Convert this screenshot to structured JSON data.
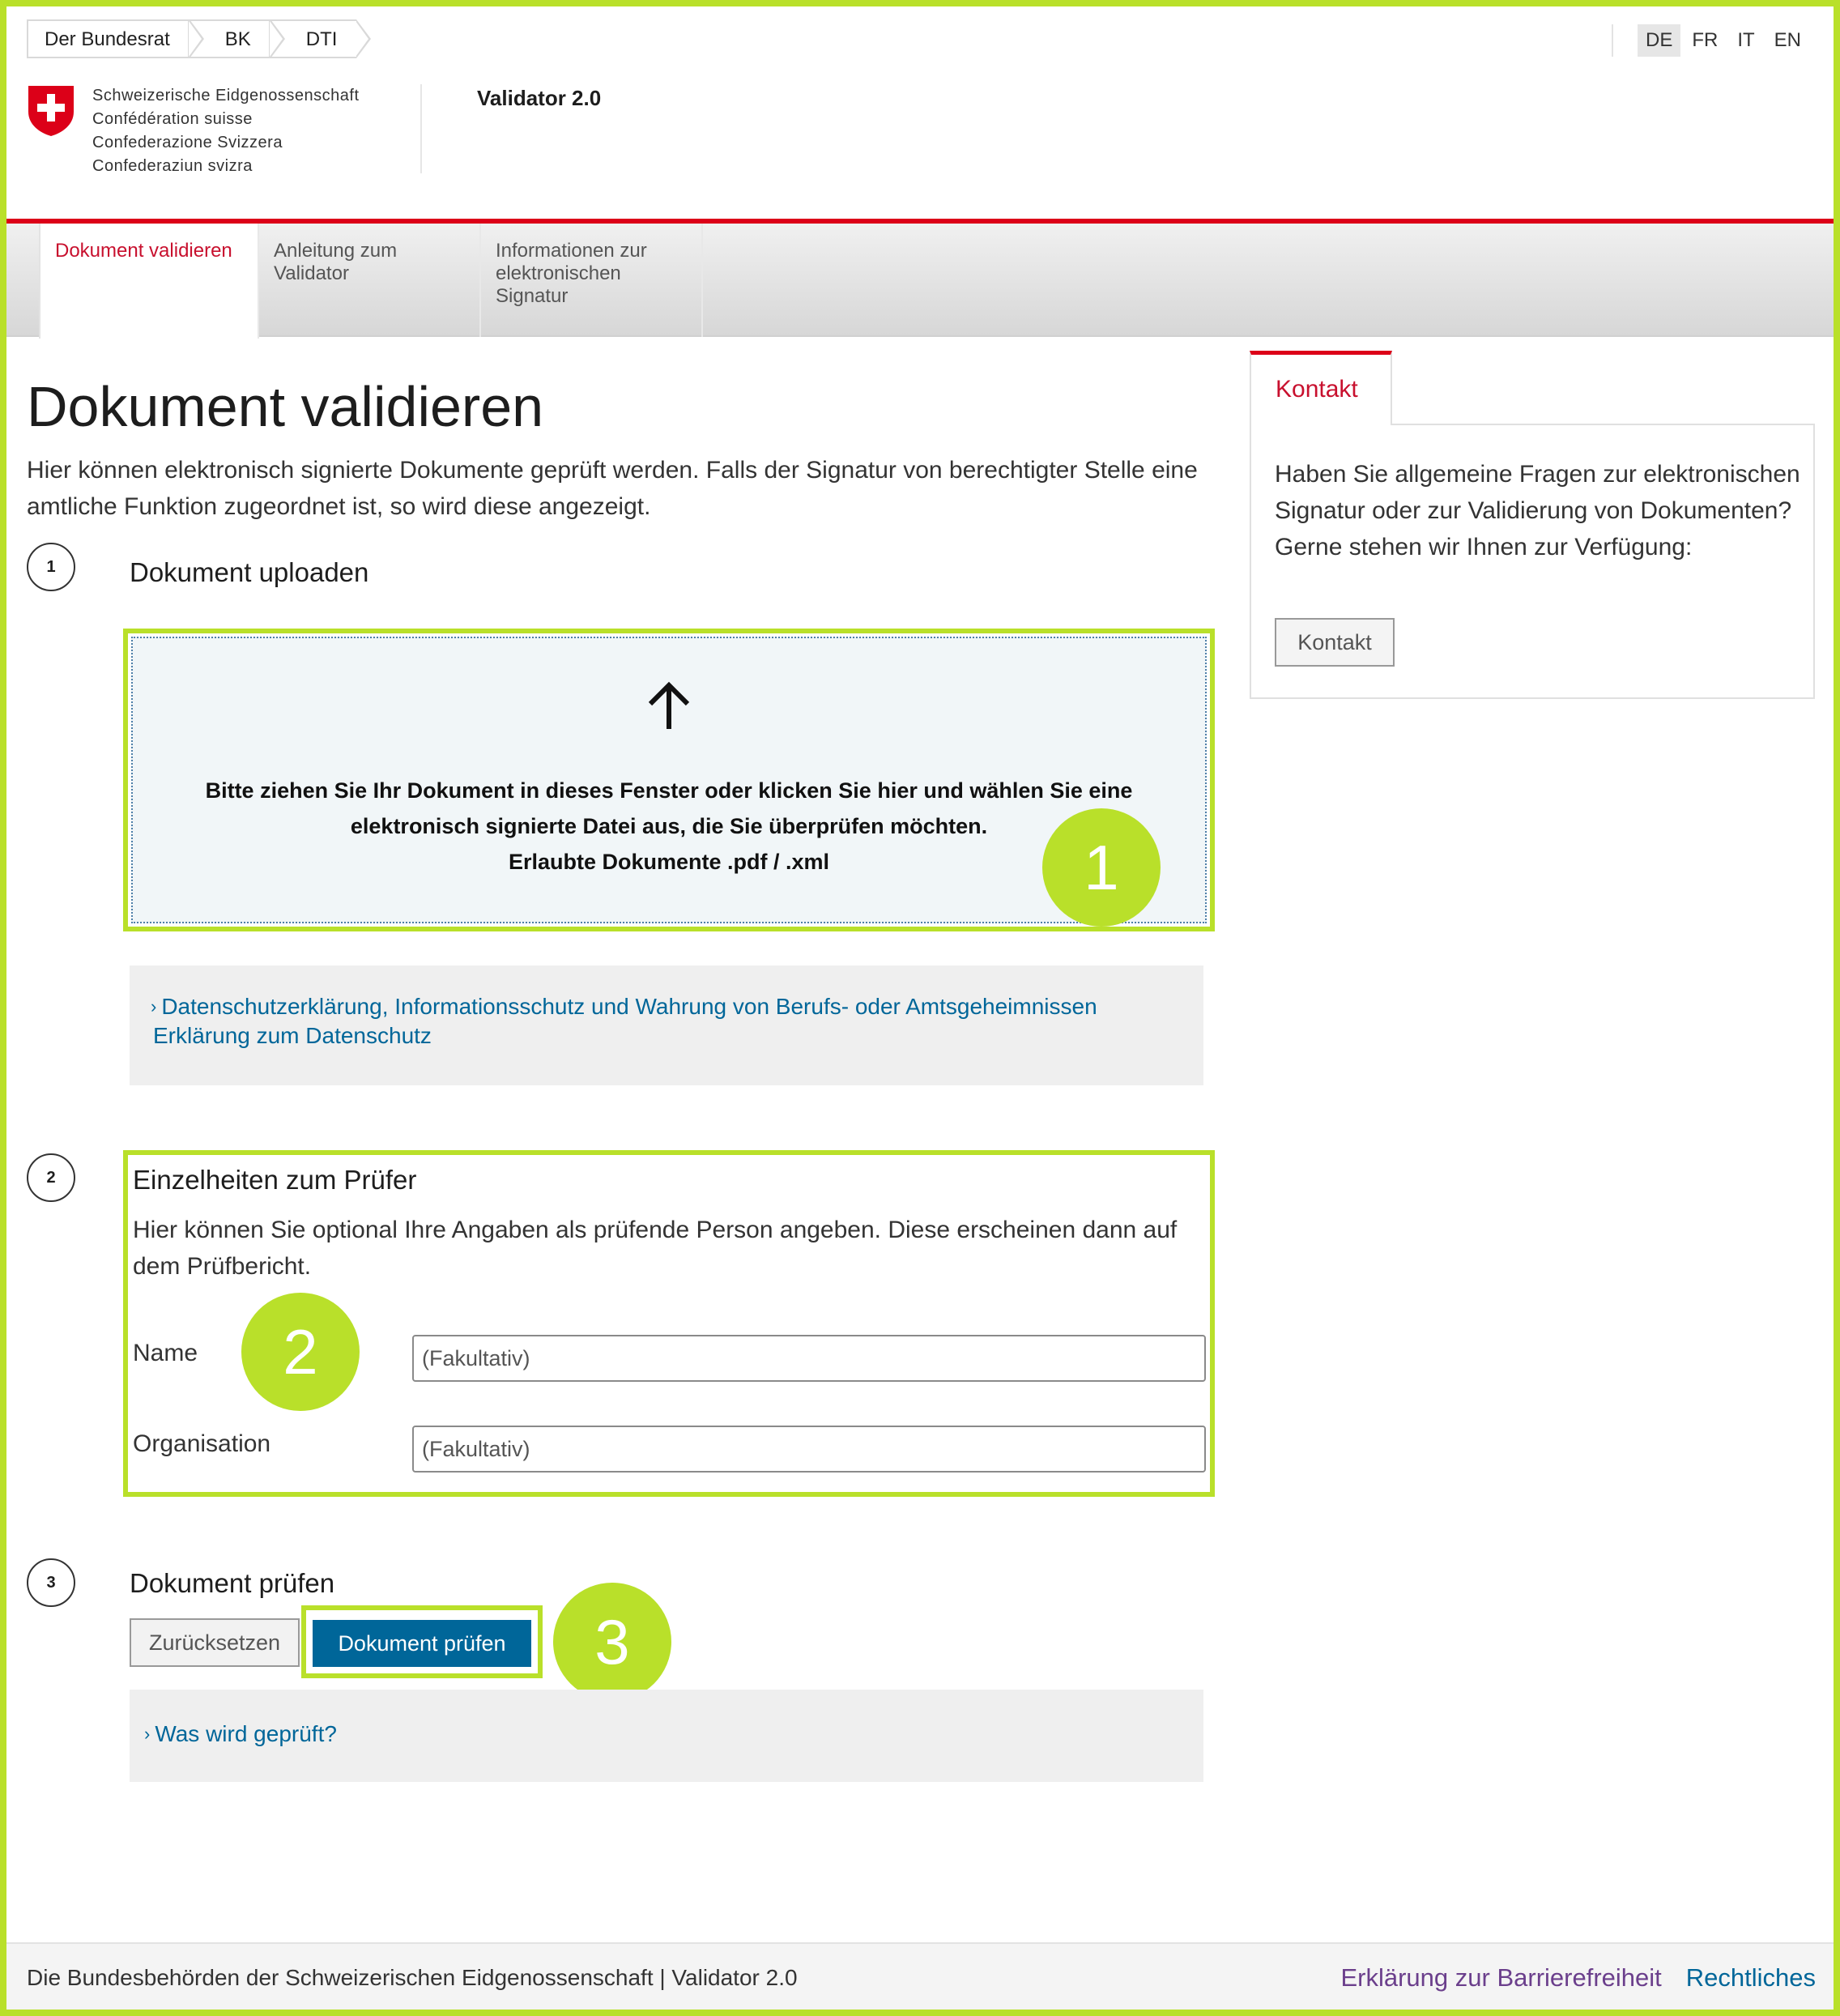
{
  "breadcrumb": [
    "Der Bundesrat",
    "BK",
    "DTI"
  ],
  "languages": {
    "items": [
      "DE",
      "FR",
      "IT",
      "EN"
    ],
    "active": "DE"
  },
  "confederation": {
    "de": "Schweizerische Eidgenossenschaft",
    "fr": "Confédération suisse",
    "it": "Confederazione Svizzera",
    "rm": "Confederaziun svizra"
  },
  "app_title": "Validator 2.0",
  "nav": {
    "tabs": [
      {
        "label": "Dokument validieren",
        "active": true
      },
      {
        "label": "Anleitung zum Validator",
        "active": false
      },
      {
        "label": "Informationen zur elektronischen Signatur",
        "active": false
      }
    ]
  },
  "main": {
    "title": "Dokument validieren",
    "intro": "Hier können elektronisch signierte Dokumente geprüft werden. Falls der Signatur von berechtigter Stelle eine amtliche Funktion zugeordnet ist, so wird diese angezeigt.",
    "step1": {
      "number": "1",
      "title": "Dokument uploaden",
      "drop_line1": "Bitte ziehen Sie Ihr Dokument in dieses Fenster oder klicken Sie hier und wählen Sie eine",
      "drop_line2": "elektronisch signierte Datei aus, die Sie überprüfen möchten.",
      "drop_line3": "Erlaubte Dokumente .pdf / .xml",
      "privacy_link": "Datenschutzerklärung, Informationsschutz und Wahrung von Berufs- oder Amtsgeheimnissen",
      "privacy_link2": "Erklärung zum Datenschutz"
    },
    "step2": {
      "number": "2",
      "title": "Einzelheiten zum Prüfer",
      "description": "Hier können Sie optional Ihre Angaben als prüfende Person angeben. Diese erscheinen dann auf dem Prüfbericht.",
      "name_label": "Name",
      "name_placeholder": "(Fakultativ)",
      "org_label": "Organisation",
      "org_placeholder": "(Fakultativ)"
    },
    "step3": {
      "number": "3",
      "title": "Dokument prüfen",
      "reset_label": "Zurücksetzen",
      "check_label": "Dokument prüfen",
      "what_link": "Was wird geprüft?"
    }
  },
  "annotations": {
    "badge1": "1",
    "badge2": "2",
    "badge3": "3",
    "color": "#b9e02a"
  },
  "sidebar": {
    "tab_label": "Kontakt",
    "text": "Haben Sie allgemeine Fragen zur elektronischen Signatur oder zur Validierung von Dokumenten? Gerne stehen wir Ihnen zur Verfügung:",
    "button_label": "Kontakt"
  },
  "footer": {
    "left_text": "Die Bundesbehörden der Schweizerischen Eidgenossenschaft | Validator 2.0",
    "links": [
      "Erklärung zur Barrierefreiheit",
      "Rechtliches"
    ]
  },
  "colors": {
    "accent_red": "#dc0018",
    "link_blue": "#006699",
    "button_blue": "#006699",
    "highlight_green": "#b9e02a"
  }
}
